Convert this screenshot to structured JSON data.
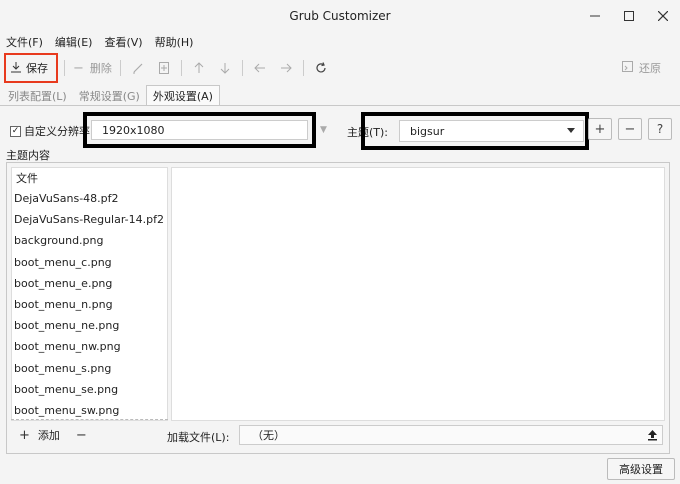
{
  "window": {
    "title": "Grub Customizer"
  },
  "menu": [
    "文件(F)",
    "编辑(E)",
    "查看(V)",
    "帮助(H)"
  ],
  "toolbar": {
    "save_label": "保存",
    "delete_label": "删除",
    "revert_label": "还原"
  },
  "tabs": [
    {
      "label": "列表配置(L)",
      "active": false
    },
    {
      "label": "常规设置(G)",
      "active": false
    },
    {
      "label": "外观设置(A)",
      "active": true
    }
  ],
  "appearance": {
    "custom_resolution_label": "自定义分辨率",
    "custom_resolution_checked": true,
    "resolution_value": "1920x1080",
    "theme_label": "主题(T):",
    "theme_value": "bigsur",
    "theme_content_label": "主题内容"
  },
  "file_list": {
    "header": "文件",
    "items": [
      "DejaVuSans-48.pf2",
      "DejaVuSans-Regular-14.pf2",
      "background.png",
      "boot_menu_c.png",
      "boot_menu_e.png",
      "boot_menu_n.png",
      "boot_menu_ne.png",
      "boot_menu_nw.png",
      "boot_menu_s.png",
      "boot_menu_se.png",
      "boot_menu_sw.png"
    ],
    "add_label": "添加"
  },
  "load_file": {
    "label": "加载文件(L):",
    "value": "（无）"
  },
  "advanced_button": "高级设置",
  "colors": {
    "highlight_red": "#e83a1e",
    "annotation_black": "#000000"
  }
}
